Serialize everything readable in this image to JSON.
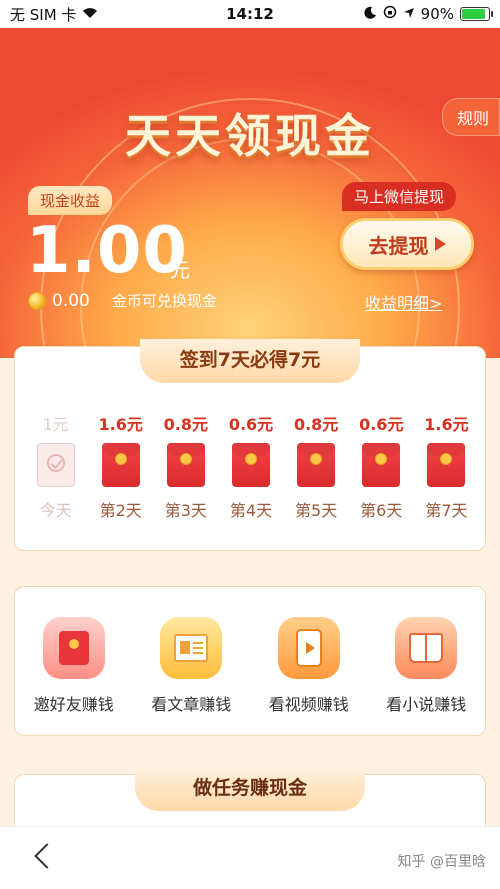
{
  "status_bar": {
    "carrier": "无 SIM 卡",
    "time": "14:12",
    "battery": "90%",
    "battery_level": 0.9
  },
  "header": {
    "title": "天天领现金",
    "rules_label": "规则"
  },
  "earnings": {
    "label": "现金收益",
    "amount": "1.00",
    "unit": "元",
    "coin_value": "0.00",
    "coin_text": "金币可兑换现金",
    "detail_link": "收益明细>"
  },
  "withdraw": {
    "tip": "马上微信提现",
    "button_label": "去提现"
  },
  "signin": {
    "title": "签到7天必得7元",
    "days": [
      {
        "amount": "1元",
        "label": "今天",
        "done": true
      },
      {
        "amount": "1.6元",
        "label": "第2天",
        "done": false
      },
      {
        "amount": "0.8元",
        "label": "第3天",
        "done": false
      },
      {
        "amount": "0.6元",
        "label": "第4天",
        "done": false
      },
      {
        "amount": "0.8元",
        "label": "第5天",
        "done": false
      },
      {
        "amount": "0.6元",
        "label": "第6天",
        "done": false
      },
      {
        "amount": "1.6元",
        "label": "第7天",
        "done": false
      }
    ]
  },
  "earn_options": [
    {
      "label": "邀好友赚钱",
      "icon": "red-envelope-icon"
    },
    {
      "label": "看文章赚钱",
      "icon": "article-icon"
    },
    {
      "label": "看视频赚钱",
      "icon": "video-icon"
    },
    {
      "label": "看小说赚钱",
      "icon": "book-icon"
    }
  ],
  "tasks": {
    "title": "做任务赚现金"
  },
  "watermark": "知乎 @百里晗",
  "colors": {
    "primary_red": "#d8321f",
    "hero_orange": "#f5643a",
    "ribbon_cream": "#ffd9a8"
  }
}
